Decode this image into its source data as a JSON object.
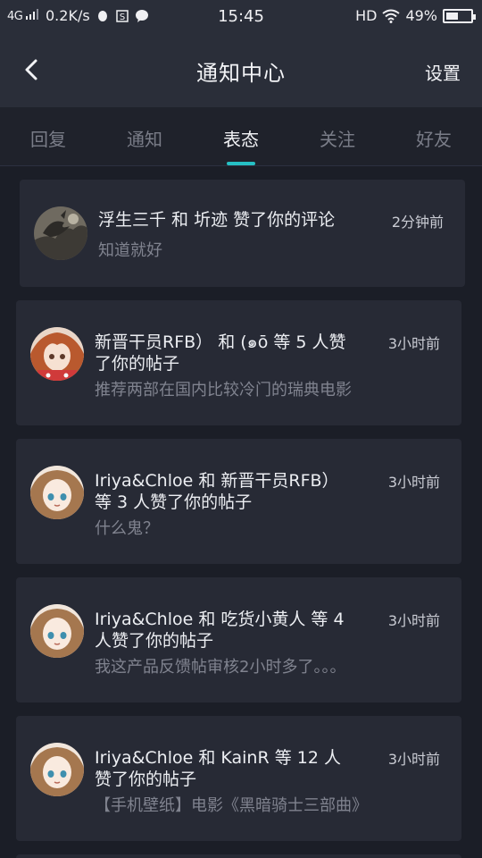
{
  "status_bar": {
    "network": "4G",
    "speed": "0.2K/s",
    "time": "15:45",
    "hd": "HD",
    "battery": "49%",
    "battery_level": 0.49
  },
  "header": {
    "title": "通知中心",
    "settings_label": "设置"
  },
  "tabs": [
    {
      "label": "回复"
    },
    {
      "label": "通知"
    },
    {
      "label": "表态",
      "active": true
    },
    {
      "label": "关注"
    },
    {
      "label": "好友"
    }
  ],
  "notifications": [
    {
      "avatar": "dragon-avatar",
      "line1": "浮生三千 和 圻迹 赞了你的评论",
      "line2": "",
      "subtitle": "知道就好",
      "time": "2分钟前"
    },
    {
      "avatar": "anime-girl-red-avatar",
      "line1": "新晋干员RFB） 和 (๑ō 等 5 人赞",
      "line2": "了你的帖子",
      "subtitle": "推荐两部在国内比较冷门的瑞典电影",
      "time": "3小时前"
    },
    {
      "avatar": "anime-girl-brown-avatar",
      "line1": "Iriya&Chloe 和 新晋干员RFB）",
      "line2": "等 3 人赞了你的帖子",
      "subtitle": "什么鬼？",
      "time": "3小时前"
    },
    {
      "avatar": "anime-girl-brown-avatar",
      "line1": "Iriya&Chloe 和 吃货小黄人 等 4",
      "line2": "人赞了你的帖子",
      "subtitle": "我这产品反馈帖审核2小时多了。。。",
      "time": "3小时前"
    },
    {
      "avatar": "anime-girl-brown-avatar",
      "line1": "Iriya&Chloe 和 KainR 等 12 人",
      "line2": "赞了你的帖子",
      "subtitle": "【手机壁纸】电影《黑暗骑士三部曲》",
      "time": "3小时前"
    }
  ]
}
